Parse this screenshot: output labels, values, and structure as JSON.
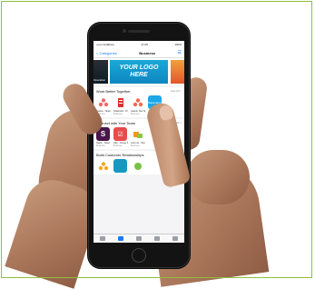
{
  "phone_screen": {
    "status": {
      "carrier": "•••oo Vodafone",
      "time": "21:05",
      "battery": "100%"
    },
    "nav": {
      "back_label": "< Categories",
      "title": "Business"
    },
    "banner": {
      "logo_text_line1": "YOUR LOGO",
      "logo_text_line2": "HERE",
      "left_caption": "Operation"
    },
    "sections": [
      {
        "title": "Work Better Together",
        "see_all": "See All >",
        "apps": [
          {
            "name": "Asana - Team Colab...",
            "category": "Business"
          },
          {
            "name": "Notebook - Projects, To...",
            "category": "Business"
          },
          {
            "name": "Asana: Tea Tasks & P...",
            "category": "Business"
          },
          {
            "name": "Basecamp",
            "category": ""
          }
        ]
      },
      {
        "title": "Connect with Your Team",
        "see_all": "See All >",
        "apps": [
          {
            "name": "Slack - Team Communica...",
            "category": "Business"
          },
          {
            "name": "Glip - Group Messaging...",
            "category": "Business"
          },
          {
            "name": "Join.me - Simple Meeti...",
            "category": "Business"
          }
        ]
      },
      {
        "title": "Build Customer Relationships",
        "see_all": "",
        "apps": [
          {
            "name": "",
            "category": ""
          },
          {
            "name": "",
            "category": ""
          },
          {
            "name": "",
            "category": ""
          }
        ]
      }
    ]
  },
  "colors": {
    "frame_border": "#8fbf3e",
    "banner_blue": "#1aa9d6",
    "ios_blue": "#1a7cf5",
    "skin": "#b98466"
  }
}
